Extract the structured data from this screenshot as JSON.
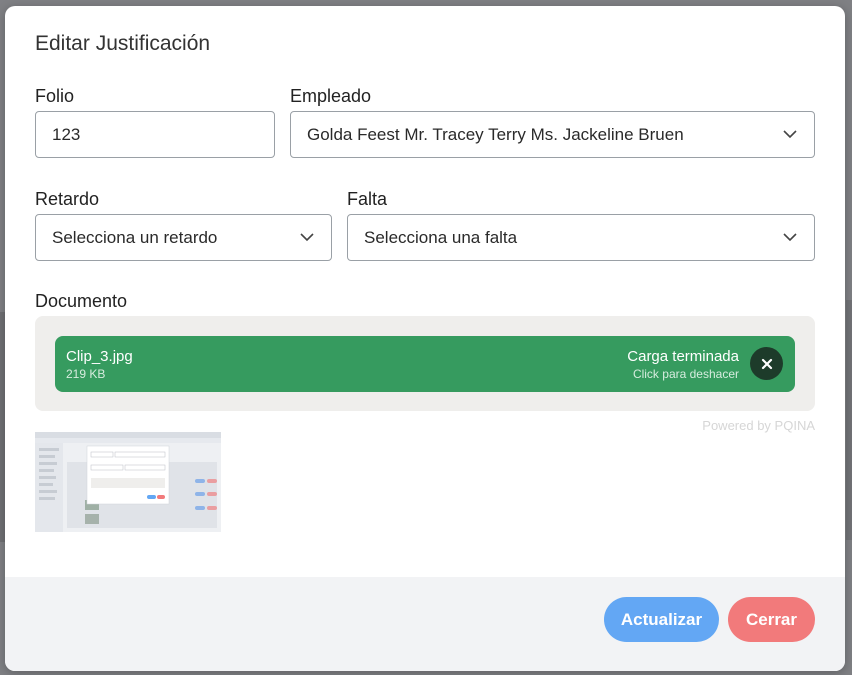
{
  "modal": {
    "title": "Editar Justificación"
  },
  "form": {
    "folio": {
      "label": "Folio",
      "value": "123"
    },
    "empleado": {
      "label": "Empleado",
      "value": "Golda Feest Mr. Tracey Terry Ms. Jackeline Bruen"
    },
    "retardo": {
      "label": "Retardo",
      "value": "Selecciona un retardo"
    },
    "falta": {
      "label": "Falta",
      "value": "Selecciona una falta"
    },
    "documento": {
      "label": "Documento"
    }
  },
  "upload": {
    "file_name": "Clip_3.jpg",
    "file_size": "219 KB",
    "status": "Carga terminada",
    "hint": "Click para deshacer",
    "powered_by": "Powered by PQINA"
  },
  "footer": {
    "update_label": "Actualizar",
    "close_label": "Cerrar"
  },
  "colors": {
    "upload_success": "#369b5f",
    "update_button": "#63a7f4",
    "close_button": "#f27a7b"
  },
  "icons": {
    "dropdown": "chevron-down-icon",
    "remove": "close-icon"
  }
}
